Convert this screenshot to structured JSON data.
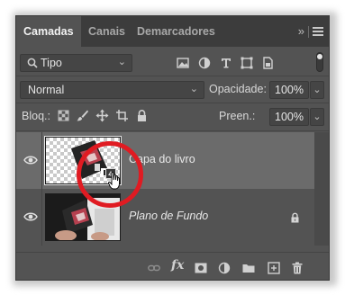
{
  "tabs": [
    {
      "label": "Camadas",
      "active": true
    },
    {
      "label": "Canais",
      "active": false
    },
    {
      "label": "Demarcadores",
      "active": false
    }
  ],
  "panel": {
    "collapse_glyph": "»",
    "menu_icon": "hamburger-icon"
  },
  "filter": {
    "kind_label": "Tipo",
    "icons": [
      "pixel-filter-icon",
      "adjustment-filter-icon",
      "type-filter-icon",
      "shape-filter-icon",
      "smart-object-filter-icon"
    ]
  },
  "blend": {
    "mode": "Normal",
    "opacity_label": "Opacidade:",
    "opacity_value": "100%"
  },
  "lock": {
    "label": "Bloq.:",
    "fill_label": "Preen.:",
    "fill_value": "100%"
  },
  "layers": [
    {
      "name": "Capa do livro",
      "selected": true,
      "visible": true,
      "smart_object": true,
      "locked": false
    },
    {
      "name": "Plano de Fundo",
      "selected": false,
      "visible": true,
      "smart_object": false,
      "locked": true
    }
  ],
  "colors": {
    "panel_bg": "#535353",
    "tab_bar": "#3c3c3c",
    "selected_layer": "#6b6b6b",
    "annotation": "#e01b22"
  }
}
